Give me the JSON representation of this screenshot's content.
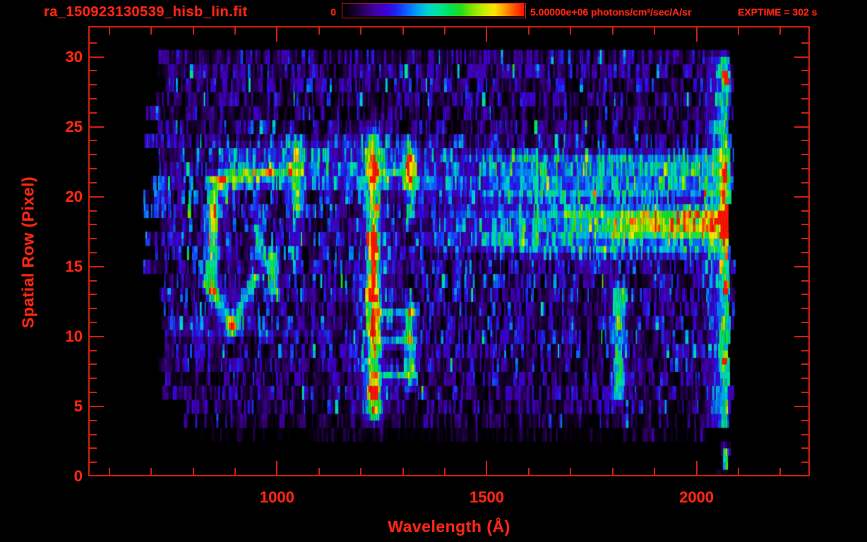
{
  "chart_data": {
    "type": "heatmap",
    "title": "ra_150923130539_hisb_lin.fit",
    "xlabel": "Wavelength (Å)",
    "ylabel": "Spatial Row (Pixel)",
    "xlim": [
      550,
      2270
    ],
    "ylim": [
      0,
      32.2
    ],
    "xticks": [
      1000,
      1500,
      2000
    ],
    "xtick_minor_step": 100,
    "yticks": [
      0,
      5,
      10,
      15,
      20,
      25,
      30
    ],
    "ytick_minor_step": 1,
    "grid": false,
    "colorbar": {
      "min": 0,
      "max": 5000000,
      "min_label": "0",
      "max_label": "5.00000e+06 photons/cm²/sec/A/sr",
      "units": "photons/cm²/sec/A/sr",
      "exptime_label": "EXPTIME = 302 s",
      "exptime_s": 302
    },
    "axis_color": "#cf2010",
    "text_color": "#f82713",
    "noise_seed": 1337,
    "data_extent": {
      "wavelength": [
        685,
        2085
      ],
      "rows": [
        0,
        30.5
      ]
    },
    "colormap": [
      [
        0.0,
        "#000000"
      ],
      [
        0.05,
        "#120024"
      ],
      [
        0.12,
        "#30006a"
      ],
      [
        0.18,
        "#4400aa"
      ],
      [
        0.24,
        "#3a00d8"
      ],
      [
        0.3,
        "#1c2cf0"
      ],
      [
        0.36,
        "#0b6cff"
      ],
      [
        0.42,
        "#00aaf0"
      ],
      [
        0.47,
        "#00d4cc"
      ],
      [
        0.53,
        "#00e49a"
      ],
      [
        0.59,
        "#00e25c"
      ],
      [
        0.65,
        "#22dc1e"
      ],
      [
        0.71,
        "#7ce400"
      ],
      [
        0.78,
        "#c8ee00"
      ],
      [
        0.84,
        "#ffe400"
      ],
      [
        0.9,
        "#ff9800"
      ],
      [
        0.95,
        "#ff5000"
      ],
      [
        1.0,
        "#ff1400"
      ]
    ],
    "row_profile": [
      [
        2060,
        2076,
        0.05,
        0.5
      ],
      [
        2058,
        2076,
        0.06,
        0.4
      ],
      [
        2050,
        2078,
        0.06,
        0.3
      ],
      [
        820,
        2015,
        0.045,
        0.5
      ],
      [
        778,
        2082,
        0.075,
        0.25
      ],
      [
        760,
        2082,
        0.1,
        0.15
      ],
      [
        735,
        2082,
        0.105,
        0.12
      ],
      [
        728,
        2082,
        0.1,
        0.15
      ],
      [
        718,
        2082,
        0.11,
        0.12
      ],
      [
        715,
        2082,
        0.115,
        0.12
      ],
      [
        712,
        2082,
        0.125,
        0.1
      ],
      [
        710,
        2082,
        0.12,
        0.1
      ],
      [
        706,
        2082,
        0.115,
        0.12
      ],
      [
        720,
        2082,
        0.13,
        0.08
      ],
      [
        712,
        2082,
        0.135,
        0.08
      ],
      [
        705,
        2082,
        0.13,
        0.08
      ],
      [
        700,
        2082,
        0.135,
        0.08
      ],
      [
        700,
        2082,
        0.14,
        0.07
      ],
      [
        702,
        2082,
        0.135,
        0.07
      ],
      [
        700,
        2082,
        0.14,
        0.07
      ],
      [
        698,
        2082,
        0.145,
        0.06
      ],
      [
        700,
        2082,
        0.14,
        0.06
      ],
      [
        700,
        2082,
        0.145,
        0.06
      ],
      [
        700,
        2082,
        0.14,
        0.07
      ],
      [
        698,
        2082,
        0.13,
        0.08
      ],
      [
        705,
        2082,
        0.1,
        0.14
      ],
      [
        702,
        2082,
        0.095,
        0.16
      ],
      [
        705,
        2082,
        0.1,
        0.15
      ],
      [
        712,
        2082,
        0.11,
        0.12
      ],
      [
        718,
        2082,
        0.105,
        0.12
      ],
      [
        725,
        2080,
        0.1,
        0.14
      ]
    ],
    "features": [
      {
        "t": "seg",
        "x0": 845,
        "r0": 21.3,
        "x1": 985,
        "r1": 21.7,
        "w": 9,
        "a": 0.4
      },
      {
        "t": "seg",
        "x0": 985,
        "r0": 21.7,
        "x1": 1040,
        "r1": 21.9,
        "w": 8,
        "a": 0.26
      },
      {
        "t": "seg",
        "x0": 846,
        "r0": 19.0,
        "x1": 855,
        "r1": 21.0,
        "w": 9,
        "a": 0.45
      },
      {
        "t": "seg",
        "x0": 843,
        "r0": 13.4,
        "x1": 846,
        "r1": 19.0,
        "w": 10,
        "a": 0.48
      },
      {
        "t": "seg",
        "x0": 843,
        "r0": 13.4,
        "x1": 895,
        "r1": 10.6,
        "w": 10,
        "a": 0.46
      },
      {
        "t": "seg",
        "x0": 895,
        "r0": 10.6,
        "x1": 945,
        "r1": 14.3,
        "w": 9,
        "a": 0.4
      },
      {
        "t": "seg",
        "x0": 948,
        "r0": 17.8,
        "x1": 975,
        "r1": 15.0,
        "w": 8,
        "a": 0.34
      },
      {
        "t": "seg",
        "x0": 990,
        "r0": 13.2,
        "x1": 990,
        "r1": 15.9,
        "w": 8,
        "a": 0.36
      },
      {
        "t": "seg",
        "x0": 1045,
        "r0": 19.2,
        "x1": 1045,
        "r1": 24.0,
        "w": 8,
        "a": 0.42
      },
      {
        "t": "seg",
        "x0": 1045,
        "r0": 14.6,
        "x1": 1045,
        "r1": 19.2,
        "w": 7,
        "a": 0.2
      },
      {
        "t": "seg",
        "x0": 1230,
        "r0": 17.2,
        "x1": 1230,
        "r1": 24.3,
        "w": 9,
        "a": 0.42
      },
      {
        "t": "seg",
        "x0": 1230,
        "r0": 21.2,
        "x1": 1230,
        "r1": 22.5,
        "w": 9,
        "a": 0.25
      },
      {
        "t": "seg",
        "x0": 1230,
        "r0": 13.0,
        "x1": 1230,
        "r1": 17.2,
        "w": 9,
        "a": 0.65
      },
      {
        "t": "seg",
        "x0": 1230,
        "r0": 10.4,
        "x1": 1230,
        "r1": 13.0,
        "w": 8,
        "a": 0.72
      },
      {
        "t": "seg",
        "x0": 1230,
        "r0": 6.2,
        "x1": 1230,
        "r1": 10.4,
        "w": 9,
        "a": 0.55
      },
      {
        "t": "seg",
        "x0": 1230,
        "r0": 4.6,
        "x1": 1230,
        "r1": 6.2,
        "w": 11,
        "a": 0.62
      },
      {
        "t": "seg",
        "x0": 1230,
        "r0": 4.6,
        "x1": 1230,
        "r1": 24.3,
        "w": 24,
        "a": 0.14
      },
      {
        "t": "seg",
        "x0": 1240,
        "r0": 21.8,
        "x1": 1315,
        "r1": 21.8,
        "w": 8,
        "a": 0.2
      },
      {
        "t": "seg",
        "x0": 1317,
        "r0": 21.0,
        "x1": 1317,
        "r1": 22.6,
        "w": 9,
        "a": 0.48
      },
      {
        "t": "seg",
        "x0": 1317,
        "r0": 18.5,
        "x1": 1317,
        "r1": 21.0,
        "w": 8,
        "a": 0.28
      },
      {
        "t": "seg",
        "x0": 1317,
        "r0": 22.6,
        "x1": 1317,
        "r1": 24.0,
        "w": 8,
        "a": 0.3
      },
      {
        "t": "seg",
        "x0": 1318,
        "r0": 6.6,
        "x1": 1318,
        "r1": 12.0,
        "w": 10,
        "a": 0.38
      },
      {
        "t": "seg",
        "x0": 1242,
        "r0": 11.7,
        "x1": 1318,
        "r1": 11.7,
        "w": 8,
        "a": 0.32
      },
      {
        "t": "seg",
        "x0": 1242,
        "r0": 9.6,
        "x1": 1318,
        "r1": 9.6,
        "w": 8,
        "a": 0.3
      },
      {
        "t": "seg",
        "x0": 1242,
        "r0": 7.3,
        "x1": 1318,
        "r1": 7.3,
        "w": 8,
        "a": 0.32
      },
      {
        "t": "band",
        "x0": 830,
        "x1": 1480,
        "r0": 20.3,
        "r1": 24.0,
        "a": 0.14,
        "fx0": 60,
        "fx1": 200,
        "fr": 0.5
      },
      {
        "t": "band",
        "x0": 700,
        "x1": 1190,
        "r0": 9.8,
        "r1": 11.6,
        "a": 0.08,
        "fx0": 60,
        "fx1": 150,
        "fr": 0.5
      },
      {
        "t": "band",
        "x0": 1340,
        "x1": 2080,
        "r0": 19.5,
        "r1": 23.4,
        "a": 0.26,
        "fx0": 260,
        "fx1": 10,
        "fr": 0.5
      },
      {
        "t": "band",
        "x0": 1300,
        "x1": 2080,
        "r0": 16.0,
        "r1": 19.5,
        "a": 0.24,
        "fx0": 260,
        "fx1": 10,
        "fr": 0.4
      },
      {
        "t": "band",
        "x0": 1650,
        "x1": 2080,
        "r0": 16.9,
        "r1": 19.4,
        "a": 0.2,
        "fx0": 160,
        "fx1": 10,
        "fr": 0.3
      },
      {
        "t": "band",
        "x0": 1780,
        "x1": 2072,
        "r0": 17.2,
        "r1": 19.0,
        "a": 0.2,
        "fx0": 120,
        "fx1": 20,
        "fr": 0.3
      },
      {
        "t": "band",
        "x0": 1500,
        "x1": 2080,
        "r0": 15.5,
        "r1": 16.6,
        "a": 0.1,
        "fx0": 200,
        "fx1": 10,
        "fr": 0.3
      },
      {
        "t": "band",
        "x0": 1950,
        "x1": 2005,
        "r0": 17.3,
        "r1": 18.7,
        "a": 0.12,
        "fx0": 30,
        "fx1": 30,
        "fr": 0.3
      },
      {
        "t": "seg",
        "x0": 1815,
        "r0": 5.8,
        "x1": 1815,
        "r1": 13.2,
        "w": 11,
        "a": 0.36
      },
      {
        "t": "seg",
        "x0": 1815,
        "r0": 10.8,
        "x1": 1815,
        "r1": 13.2,
        "w": 12,
        "a": 0.12
      },
      {
        "t": "band",
        "x0": 2012,
        "x1": 2082,
        "r0": 2.2,
        "r1": 30.4,
        "a": 0.24,
        "fx0": 40,
        "fx1": 8,
        "fr": 0.6
      },
      {
        "t": "band",
        "x0": 2052,
        "x1": 2082,
        "r0": 2.2,
        "r1": 30.4,
        "a": 0.17,
        "fx0": 10,
        "fx1": 6,
        "fr": 0.5
      },
      {
        "t": "band",
        "x0": 2060,
        "x1": 2076,
        "r0": 0.2,
        "r1": 2.4,
        "a": 0.15,
        "fx0": 8,
        "fx1": 8,
        "fr": 0.3
      },
      {
        "t": "seg",
        "x0": 2070,
        "r0": 17.4,
        "x1": 2070,
        "r1": 19.0,
        "w": 4,
        "a": 0.9
      },
      {
        "t": "seg",
        "x0": 2070,
        "r0": 28.2,
        "x1": 2070,
        "r1": 28.8,
        "w": 4,
        "a": 0.8
      },
      {
        "t": "seg",
        "x0": 2070,
        "r0": 13.2,
        "x1": 2070,
        "r1": 13.8,
        "w": 4,
        "a": 0.75
      },
      {
        "t": "seg",
        "x0": 2068,
        "r0": 8.0,
        "x1": 2068,
        "r1": 8.6,
        "w": 4,
        "a": 0.75
      },
      {
        "t": "seg",
        "x0": 2071,
        "r0": 0.8,
        "x1": 2071,
        "r1": 1.8,
        "w": 4,
        "a": 0.7
      },
      {
        "t": "seg",
        "x0": 2070,
        "r0": 21.0,
        "x1": 2070,
        "r1": 21.6,
        "w": 4,
        "a": 0.75
      }
    ]
  }
}
